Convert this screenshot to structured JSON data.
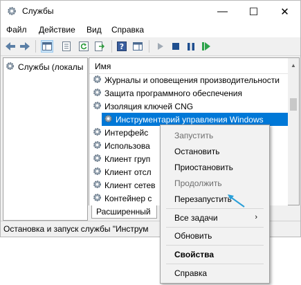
{
  "titlebar": {
    "title": "Службы",
    "minimize": "—",
    "maximize": "☐",
    "close": "✕"
  },
  "menu": [
    "Файл",
    "Действие",
    "Вид",
    "Справка"
  ],
  "tree": {
    "item": "Службы (локалы"
  },
  "list": {
    "column": "Имя",
    "rows": [
      "Журналы и оповещения производительности",
      "Защита программного обеспечения",
      "Изоляция ключей CNG",
      "Инструментарий управления Windows",
      "Интерфейс",
      "Использова",
      "Клиент груп",
      "Клиент отсл",
      "Клиент сетев",
      "Контейнер с"
    ],
    "selected_index": 3
  },
  "tab": {
    "label": "Расширенный"
  },
  "status": {
    "text": "Остановка и запуск службы \"Инструм"
  },
  "context_menu": {
    "start": "Запустить",
    "stop": "Остановить",
    "pause": "Приостановить",
    "resume": "Продолжить",
    "restart": "Перезапустить",
    "all_tasks": "Все задачи",
    "refresh": "Обновить",
    "properties": "Свойства",
    "help": "Справка"
  },
  "colors": {
    "selection": "#0078d7",
    "pointer_arrow": "#2a9fd8",
    "disabled_text": "#6d6d6d"
  }
}
